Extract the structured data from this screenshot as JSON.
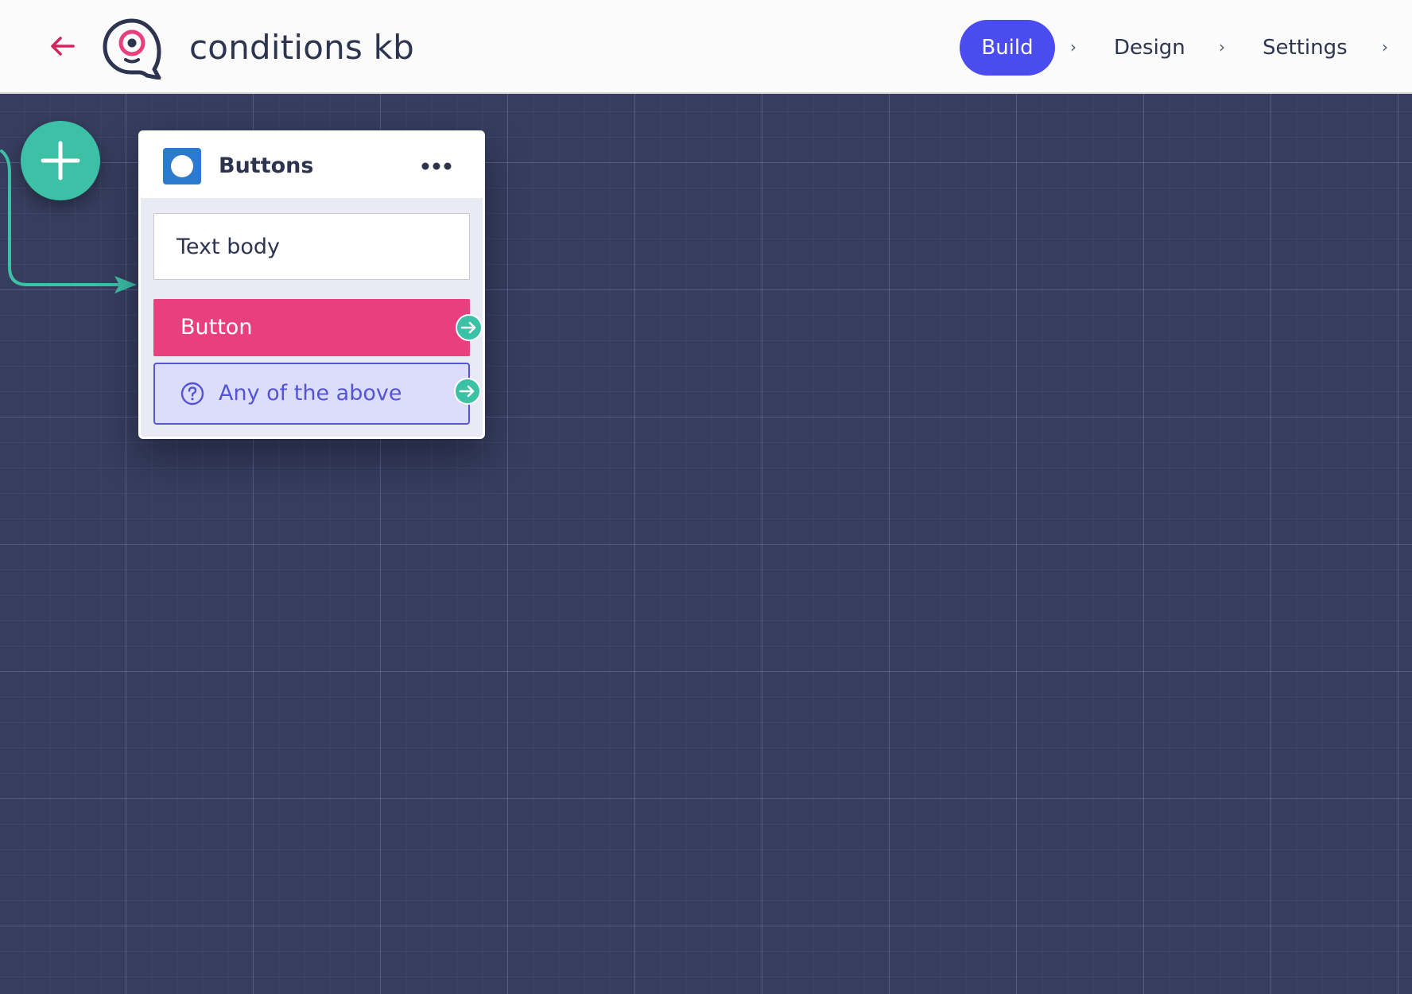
{
  "header": {
    "title": "conditions kb",
    "nav": {
      "build_label": "Build",
      "design_label": "Design",
      "settings_label": "Settings",
      "chevron": "›"
    }
  },
  "node": {
    "title": "Buttons",
    "text_body": "Text body",
    "button_label": "Button",
    "any_label": "Any of the above"
  },
  "icons": {
    "back": "arrow-left-icon",
    "logo": "chat-eye-logo",
    "add": "plus-icon",
    "node_type": "circle-block-icon",
    "menu": "more-horizontal-icon",
    "question": "question-circle-icon",
    "port": "arrow-right-icon"
  },
  "colors": {
    "accent": "#4b4cf0",
    "teal": "#3cc0a6",
    "pink": "#e8407e",
    "back_arrow": "#d0285c",
    "canvas": "#363d5e",
    "node_type_icon": "#2a7bd0"
  }
}
